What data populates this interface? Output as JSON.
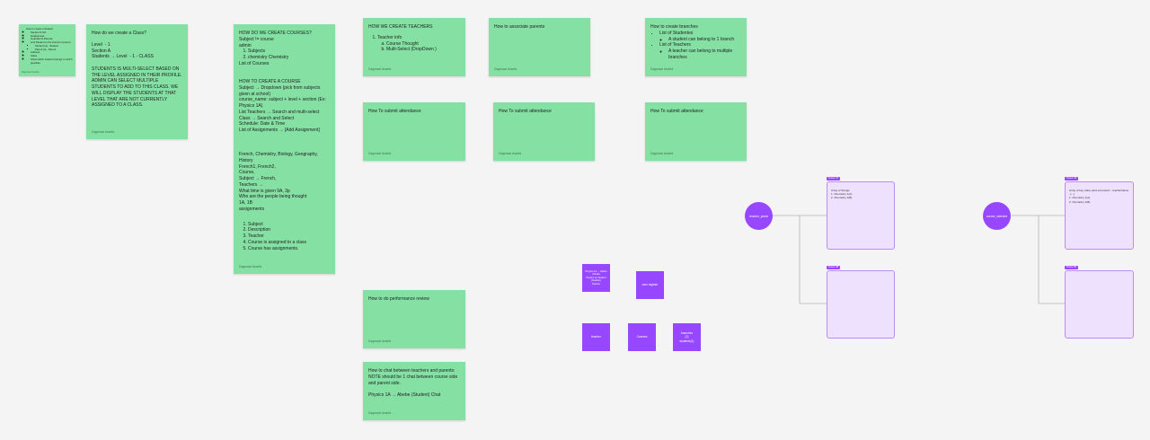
{
  "stickies": {
    "small_outline": {
      "items": [
        "How to create a Student",
        "Student S.NO",
        "Grade/Level",
        "Guardian & Parents",
        "Link Student to the branch of parent",
        "Student (a) - Student",
        "Parent (a) - Parent",
        "Address",
        "Class",
        "Show which student belongs to which guardian"
      ],
      "author": "Dagmawi Assefa"
    },
    "create_class": {
      "title": "How do we create a Class?",
      "body": "Level  - 1\nSection A\nStudents → Level  - 1 - CLASS\n\nSTUDENTS IS MULTI-SELECT BASED ON THE LEVEL ASSIGNED IN THEIR PROFILE. ADMIN CAN SELECT MULTIPLE STUDENTS TO ADD TO THIS CLASS. WE WILL DISPLAY THE STUDENTS AT THAT LEVEL THAT ARE NOT CURRENTLY ASSIGNED TO A CLASS.",
      "author": "Dagmawi Assefa"
    },
    "create_courses": {
      "intro": "HOW DO WE CREATE COURSES?\nSubject != course\nadmin",
      "subjects": [
        "Subjects",
        "chemistry Chemistry"
      ],
      "intro2": "List of Courses\n\n\nHOW TO CREATE A COURSE\nSubject → Dropdown (pick from subjects given at school)\ncourse_name: subject + level + section (Ex: Physics 1A)\nList Teachers → Search and multi-select\nClass → Search and Select\nSchedule: Date & Time\nList of Assignments → [Add Assignment]\n\n\n\nFrench, Chemistry, Biology, Geography, History\nFrench1, French2,\nCourse,\nSubject → French,\nTeachers →\nWhat time is given 9A, 3p\nWho are the people being thought\n1A, 1B\nassignments",
      "steps": [
        "Subject",
        "Description",
        "Teacher",
        "Course is assigned to a class",
        "Course has assignments."
      ],
      "author": "Dagmawi Assefa"
    },
    "create_teachers": {
      "title": "HOW WE CREATE TEACHERS",
      "item": "Teacher info",
      "subitems": [
        "Course Thought",
        "Multi-Select (DropDown )"
      ],
      "author": "Dagmawi Assefa"
    },
    "associate_parents": {
      "title": "How to associate parents",
      "author": "Dagmawi Assefa"
    },
    "create_branches": {
      "title": "How to create branches",
      "items": [
        {
          "label": "List of Studentes",
          "sub": "A student can belong to 1 branch"
        },
        {
          "label": "List of Teachers",
          "sub": "A teacher can belong to multiple branches"
        }
      ],
      "author": "Dagmawi Assefa"
    },
    "attendance_1": {
      "title": "How To submit attendance",
      "author": "Dagmawi Assefa"
    },
    "attendance_2": {
      "title": "How To submit attendance",
      "author": "Dagmawi Assefa"
    },
    "attendance_3": {
      "title": "How To submit attendance",
      "author": "Dagmawi Assefa"
    },
    "performance": {
      "title": "How to do performance review",
      "author": "Dagmawi Assefa"
    },
    "chat": {
      "body": "How to chat between teachers and parents:\nNOTE should be 1 chat between course side and parent side.\n\nPhysics 1A → Abebe (Student) Chat",
      "author": "Dagmawi Assefa"
    }
  },
  "shapes": {
    "sq_top_left": "Physics 1A → Abebe (Stude)\nPhysics 1A Student (Teacher)\nTeacher",
    "sq_top_right": "user register",
    "sq_bottom_1": "teacher",
    "sq_bottom_2": "Courses",
    "sq_bottom_3": "branches\n(2)\nstudents(1)"
  },
  "flows": {
    "left": {
      "circle": "teacher_portal",
      "tag_top": "Frame 47",
      "tag_bottom": "Frame 48",
      "frame_top_text": "Array of Strings\n1. Chemistry 1(A)\n2. Chemistry 1(B)"
    },
    "right": {
      "circle": "course_selected",
      "tag_top": "Frame 49",
      "tag_bottom": "Frame 50",
      "frame_top_text": "Array of key value pairs {courseId: - teacherName ,c...}\n1. Chemistry 1(A)\n2. Chemistry 1(B)"
    }
  }
}
